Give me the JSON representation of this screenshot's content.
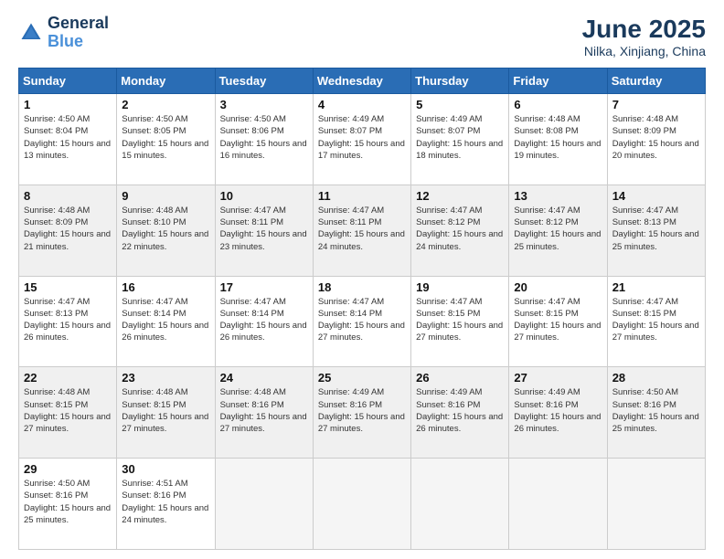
{
  "logo": {
    "line1": "General",
    "line2": "Blue"
  },
  "title": "June 2025",
  "subtitle": "Nilka, Xinjiang, China",
  "days_header": [
    "Sunday",
    "Monday",
    "Tuesday",
    "Wednesday",
    "Thursday",
    "Friday",
    "Saturday"
  ],
  "weeks": [
    {
      "shaded": false,
      "days": [
        {
          "num": "1",
          "sunrise": "4:50 AM",
          "sunset": "8:04 PM",
          "daylight": "15 hours and 13 minutes."
        },
        {
          "num": "2",
          "sunrise": "4:50 AM",
          "sunset": "8:05 PM",
          "daylight": "15 hours and 15 minutes."
        },
        {
          "num": "3",
          "sunrise": "4:50 AM",
          "sunset": "8:06 PM",
          "daylight": "15 hours and 16 minutes."
        },
        {
          "num": "4",
          "sunrise": "4:49 AM",
          "sunset": "8:07 PM",
          "daylight": "15 hours and 17 minutes."
        },
        {
          "num": "5",
          "sunrise": "4:49 AM",
          "sunset": "8:07 PM",
          "daylight": "15 hours and 18 minutes."
        },
        {
          "num": "6",
          "sunrise": "4:48 AM",
          "sunset": "8:08 PM",
          "daylight": "15 hours and 19 minutes."
        },
        {
          "num": "7",
          "sunrise": "4:48 AM",
          "sunset": "8:09 PM",
          "daylight": "15 hours and 20 minutes."
        }
      ]
    },
    {
      "shaded": true,
      "days": [
        {
          "num": "8",
          "sunrise": "4:48 AM",
          "sunset": "8:09 PM",
          "daylight": "15 hours and 21 minutes."
        },
        {
          "num": "9",
          "sunrise": "4:48 AM",
          "sunset": "8:10 PM",
          "daylight": "15 hours and 22 minutes."
        },
        {
          "num": "10",
          "sunrise": "4:47 AM",
          "sunset": "8:11 PM",
          "daylight": "15 hours and 23 minutes."
        },
        {
          "num": "11",
          "sunrise": "4:47 AM",
          "sunset": "8:11 PM",
          "daylight": "15 hours and 24 minutes."
        },
        {
          "num": "12",
          "sunrise": "4:47 AM",
          "sunset": "8:12 PM",
          "daylight": "15 hours and 24 minutes."
        },
        {
          "num": "13",
          "sunrise": "4:47 AM",
          "sunset": "8:12 PM",
          "daylight": "15 hours and 25 minutes."
        },
        {
          "num": "14",
          "sunrise": "4:47 AM",
          "sunset": "8:13 PM",
          "daylight": "15 hours and 25 minutes."
        }
      ]
    },
    {
      "shaded": false,
      "days": [
        {
          "num": "15",
          "sunrise": "4:47 AM",
          "sunset": "8:13 PM",
          "daylight": "15 hours and 26 minutes."
        },
        {
          "num": "16",
          "sunrise": "4:47 AM",
          "sunset": "8:14 PM",
          "daylight": "15 hours and 26 minutes."
        },
        {
          "num": "17",
          "sunrise": "4:47 AM",
          "sunset": "8:14 PM",
          "daylight": "15 hours and 26 minutes."
        },
        {
          "num": "18",
          "sunrise": "4:47 AM",
          "sunset": "8:14 PM",
          "daylight": "15 hours and 27 minutes."
        },
        {
          "num": "19",
          "sunrise": "4:47 AM",
          "sunset": "8:15 PM",
          "daylight": "15 hours and 27 minutes."
        },
        {
          "num": "20",
          "sunrise": "4:47 AM",
          "sunset": "8:15 PM",
          "daylight": "15 hours and 27 minutes."
        },
        {
          "num": "21",
          "sunrise": "4:47 AM",
          "sunset": "8:15 PM",
          "daylight": "15 hours and 27 minutes."
        }
      ]
    },
    {
      "shaded": true,
      "days": [
        {
          "num": "22",
          "sunrise": "4:48 AM",
          "sunset": "8:15 PM",
          "daylight": "15 hours and 27 minutes."
        },
        {
          "num": "23",
          "sunrise": "4:48 AM",
          "sunset": "8:15 PM",
          "daylight": "15 hours and 27 minutes."
        },
        {
          "num": "24",
          "sunrise": "4:48 AM",
          "sunset": "8:16 PM",
          "daylight": "15 hours and 27 minutes."
        },
        {
          "num": "25",
          "sunrise": "4:49 AM",
          "sunset": "8:16 PM",
          "daylight": "15 hours and 27 minutes."
        },
        {
          "num": "26",
          "sunrise": "4:49 AM",
          "sunset": "8:16 PM",
          "daylight": "15 hours and 26 minutes."
        },
        {
          "num": "27",
          "sunrise": "4:49 AM",
          "sunset": "8:16 PM",
          "daylight": "15 hours and 26 minutes."
        },
        {
          "num": "28",
          "sunrise": "4:50 AM",
          "sunset": "8:16 PM",
          "daylight": "15 hours and 25 minutes."
        }
      ]
    },
    {
      "shaded": false,
      "days": [
        {
          "num": "29",
          "sunrise": "4:50 AM",
          "sunset": "8:16 PM",
          "daylight": "15 hours and 25 minutes."
        },
        {
          "num": "30",
          "sunrise": "4:51 AM",
          "sunset": "8:16 PM",
          "daylight": "15 hours and 24 minutes."
        },
        null,
        null,
        null,
        null,
        null
      ]
    }
  ]
}
